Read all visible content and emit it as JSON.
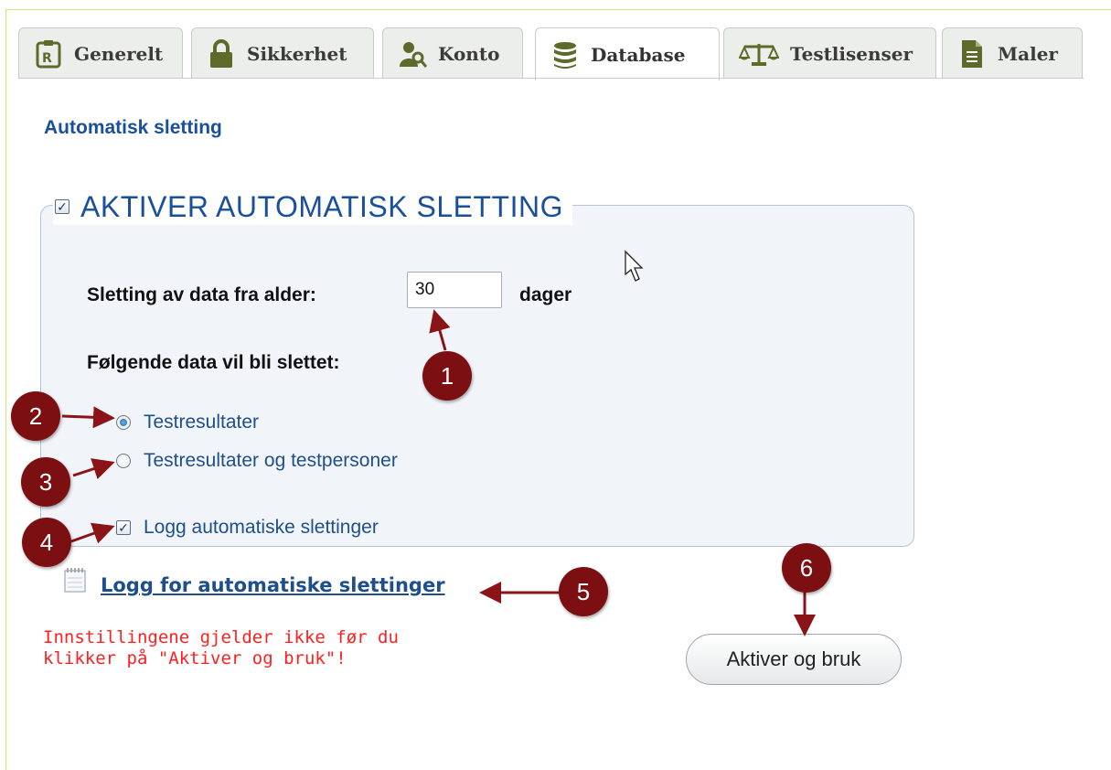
{
  "tabs": [
    {
      "label": "Generelt",
      "icon": "clipboard-icon",
      "active": false
    },
    {
      "label": "Sikkerhet",
      "icon": "lock-icon",
      "active": false
    },
    {
      "label": "Konto",
      "icon": "user-search-icon",
      "active": false
    },
    {
      "label": "Database",
      "icon": "database-icon",
      "active": true
    },
    {
      "label": "Testlisenser",
      "icon": "scales-icon",
      "active": false
    },
    {
      "label": "Maler",
      "icon": "document-icon",
      "active": false
    }
  ],
  "section_title": "Automatisk sletting",
  "fieldset": {
    "legend": "AKTIVER AUTOMATISK SLETTING",
    "legend_checked": true,
    "age_label": "Sletting av data fra alder:",
    "age_value": "30",
    "age_unit": "dager",
    "data_label": "Følgende data vil bli slettet:",
    "options": [
      {
        "label": "Testresultater",
        "selected": true
      },
      {
        "label": "Testresultater og testpersoner",
        "selected": false
      }
    ],
    "log_checkbox_label": "Logg automatiske slettinger",
    "log_checkbox_checked": true
  },
  "log_link": "Logg for automatiske slettinger",
  "warning": "Innstillingene gjelder ikke før du klikker på \"Aktiver og bruk\"!",
  "apply_button": "Aktiver og bruk",
  "markers": [
    "1",
    "2",
    "3",
    "4",
    "5",
    "6"
  ],
  "colors": {
    "heading_blue": "#1a4f9c",
    "warning_red": "#ff2020",
    "marker_red": "#7b0f12",
    "panel_bg": "#f1f5f9"
  }
}
